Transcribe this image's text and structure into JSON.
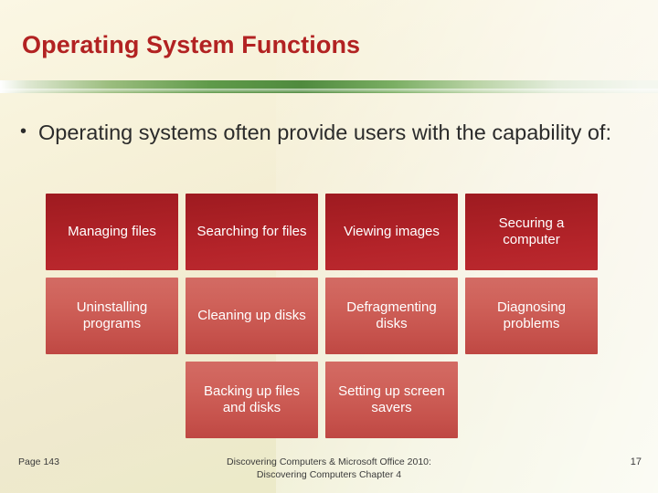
{
  "slide": {
    "title": "Operating System Functions",
    "bullet": {
      "marker": "•",
      "text": "Operating systems often provide users with the capability of:"
    },
    "grid": {
      "rows": [
        [
          {
            "label": "Managing files",
            "style": "dark"
          },
          {
            "label": "Searching for files",
            "style": "dark"
          },
          {
            "label": "Viewing images",
            "style": "dark"
          },
          {
            "label": "Securing a computer",
            "style": "dark"
          }
        ],
        [
          {
            "label": "Uninstalling programs",
            "style": "light"
          },
          {
            "label": "Cleaning up disks",
            "style": "light"
          },
          {
            "label": "Defragmenting disks",
            "style": "light"
          },
          {
            "label": "Diagnosing problems",
            "style": "light"
          }
        ],
        [
          {
            "label": "",
            "style": "empty"
          },
          {
            "label": "Backing up files and disks",
            "style": "light"
          },
          {
            "label": "Setting up screen savers",
            "style": "light"
          },
          {
            "label": "",
            "style": "empty"
          }
        ]
      ]
    },
    "footer": {
      "page_label": "Page 143",
      "center_line1": "Discovering Computers & Microsoft Office 2010:",
      "center_line2": "Discovering Computers Chapter 4",
      "slide_number": "17"
    }
  }
}
